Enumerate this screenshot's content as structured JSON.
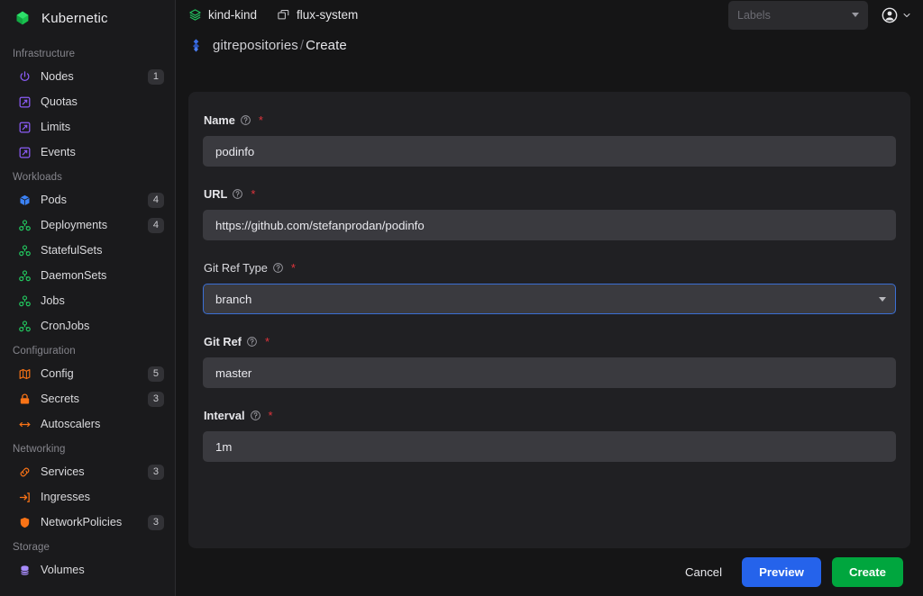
{
  "brand": {
    "name": "Kubernetic",
    "logo_icon": "cube-logo-icon"
  },
  "sidebar": {
    "sections": [
      {
        "title": "Infrastructure",
        "items": [
          {
            "label": "Nodes",
            "icon": "power-icon",
            "badge": "1",
            "color": "#8b5cf6"
          },
          {
            "label": "Quotas",
            "icon": "gauge-icon",
            "badge": "",
            "color": "#8b5cf6"
          },
          {
            "label": "Limits",
            "icon": "gauge-icon",
            "badge": "",
            "color": "#8b5cf6"
          },
          {
            "label": "Events",
            "icon": "gauge-icon",
            "badge": "",
            "color": "#8b5cf6"
          }
        ]
      },
      {
        "title": "Workloads",
        "items": [
          {
            "label": "Pods",
            "icon": "box-icon",
            "badge": "4",
            "color": "#3b82f6"
          },
          {
            "label": "Deployments",
            "icon": "clusters-icon",
            "badge": "4",
            "color": "#22c55e"
          },
          {
            "label": "StatefulSets",
            "icon": "clusters-icon",
            "badge": "",
            "color": "#22c55e"
          },
          {
            "label": "DaemonSets",
            "icon": "clusters-icon",
            "badge": "",
            "color": "#22c55e"
          },
          {
            "label": "Jobs",
            "icon": "clusters-icon",
            "badge": "",
            "color": "#22c55e"
          },
          {
            "label": "CronJobs",
            "icon": "clusters-icon",
            "badge": "",
            "color": "#22c55e"
          }
        ]
      },
      {
        "title": "Configuration",
        "items": [
          {
            "label": "Config",
            "icon": "map-icon",
            "badge": "5",
            "color": "#f97316"
          },
          {
            "label": "Secrets",
            "icon": "lock-icon",
            "badge": "3",
            "color": "#f97316"
          },
          {
            "label": "Autoscalers",
            "icon": "arrows-icon",
            "badge": "",
            "color": "#f97316"
          }
        ]
      },
      {
        "title": "Networking",
        "items": [
          {
            "label": "Services",
            "icon": "link-icon",
            "badge": "3",
            "color": "#f97316"
          },
          {
            "label": "Ingresses",
            "icon": "login-icon",
            "badge": "",
            "color": "#f97316"
          },
          {
            "label": "NetworkPolicies",
            "icon": "shield-icon",
            "badge": "3",
            "color": "#f97316"
          }
        ]
      },
      {
        "title": "Storage",
        "items": [
          {
            "label": "Volumes",
            "icon": "database-icon",
            "badge": "",
            "color": "#a78bfa"
          }
        ]
      }
    ]
  },
  "topbar": {
    "cluster": {
      "label": "kind-kind",
      "icon": "layers-icon"
    },
    "namespace": {
      "label": "flux-system",
      "icon": "copy-icon"
    },
    "labels_select": {
      "placeholder": "Labels",
      "value": ""
    },
    "account": {
      "icon": "account-circle-icon",
      "chevron": "chevron-down-icon"
    }
  },
  "breadcrumb": {
    "icon": "flux-icon",
    "resource": "gitrepositories",
    "separator": "/",
    "action": "Create"
  },
  "form": {
    "fields": [
      {
        "label": "Name",
        "required": "*",
        "value": "podinfo",
        "type": "text",
        "focused": false,
        "help": "help-icon"
      },
      {
        "label": "URL",
        "required": "*",
        "value": "https://github.com/stefanprodan/podinfo",
        "type": "text",
        "focused": false,
        "help": "help-icon"
      },
      {
        "label": "Git Ref Type",
        "required": "*",
        "value": "branch",
        "type": "select",
        "focused": true,
        "help": "help-icon"
      },
      {
        "label": "Git Ref",
        "required": "*",
        "value": "master",
        "type": "text",
        "focused": false,
        "help": "help-icon"
      },
      {
        "label": "Interval",
        "required": "*",
        "value": "1m",
        "type": "text",
        "focused": false,
        "help": "help-icon"
      }
    ]
  },
  "footer": {
    "cancel": "Cancel",
    "preview": "Preview",
    "create": "Create"
  },
  "colors": {
    "primary": "#2563eb",
    "success": "#00a63e",
    "required": "#e0343c",
    "focus_border": "#3b6fd4",
    "sidebar_bg": "#1a1a1c",
    "card_bg": "#202023",
    "input_bg": "#3a3a3f"
  }
}
